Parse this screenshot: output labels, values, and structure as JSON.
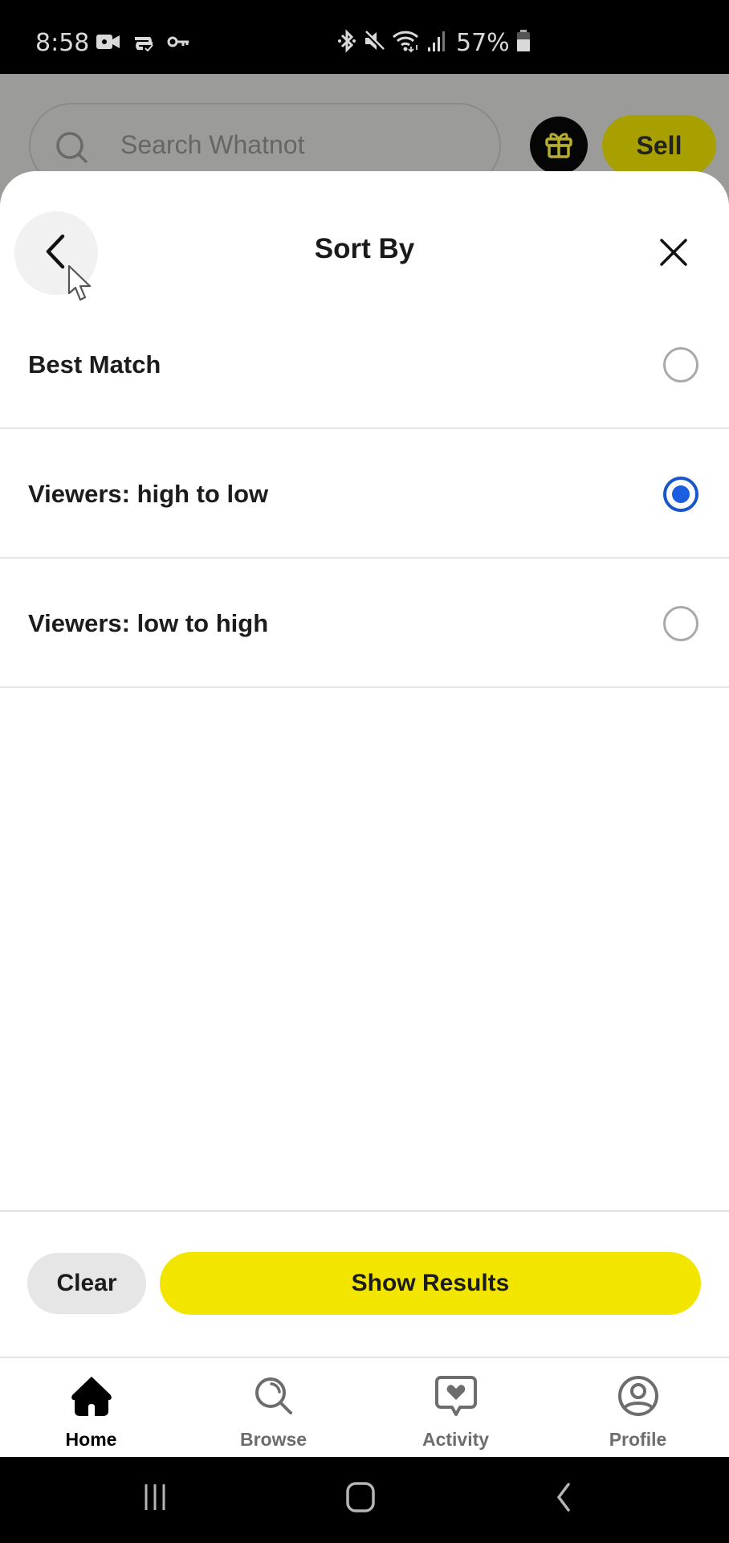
{
  "status_bar": {
    "time": "8:58",
    "battery_percent": "57%",
    "left_icons": [
      "video-camera-icon",
      "vpn-sync-icon",
      "key-icon"
    ],
    "right_icons": [
      "bluetooth-icon",
      "mute-icon",
      "wifi-icon",
      "signal-icon",
      "battery-icon"
    ]
  },
  "background_app": {
    "search_placeholder": "Search Whatnot",
    "gift_icon": "gift-icon",
    "sell_label": "Sell"
  },
  "sheet": {
    "title": "Sort By",
    "back_icon": "chevron-left-icon",
    "close_icon": "close-icon",
    "options": [
      {
        "label": "Best Match",
        "selected": false
      },
      {
        "label": "Viewers: high to low",
        "selected": true
      },
      {
        "label": "Viewers: low to high",
        "selected": false
      }
    ],
    "clear_label": "Clear",
    "show_results_label": "Show Results"
  },
  "tab_bar": {
    "tabs": [
      {
        "label": "Home",
        "icon": "home-icon",
        "active": true
      },
      {
        "label": "Browse",
        "icon": "browse-search-icon",
        "active": false
      },
      {
        "label": "Activity",
        "icon": "activity-heart-icon",
        "active": false
      },
      {
        "label": "Profile",
        "icon": "profile-icon",
        "active": false
      }
    ]
  },
  "colors": {
    "accent_yellow": "#f2e500",
    "radio_selected": "#1b5fe0",
    "dimmed_background": "#9b9c9a"
  }
}
